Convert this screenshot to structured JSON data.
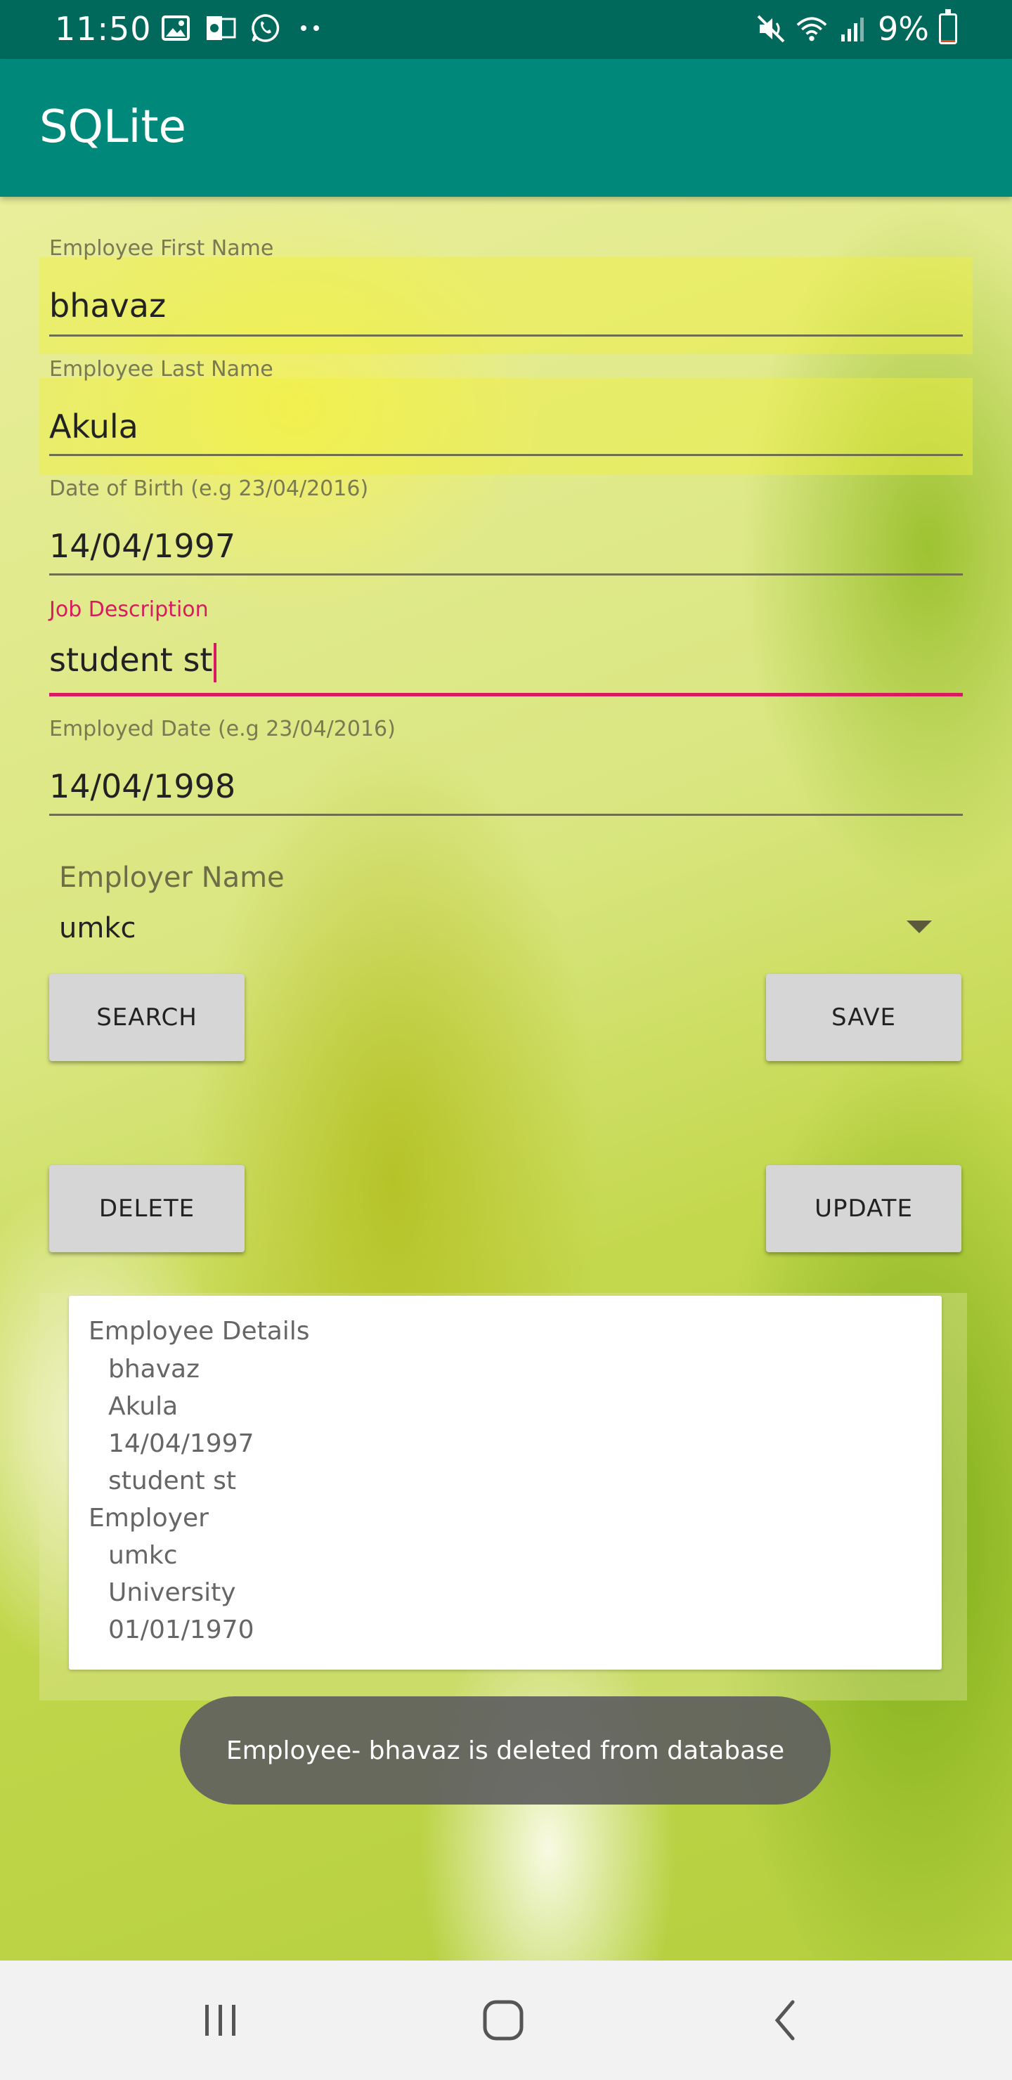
{
  "status_bar": {
    "time": "11:50",
    "battery": "9%",
    "battery_level": 0.09,
    "left_icons": [
      "image-icon",
      "outlook-icon",
      "whatsapp-icon",
      "more-dots-icon"
    ],
    "right_icons": [
      "mute-icon",
      "wifi-icon",
      "signal-icon",
      "battery-icon"
    ]
  },
  "app_bar": {
    "title": "SQLite"
  },
  "form": {
    "first_name": {
      "label": "Employee First Name",
      "value": "bhavaz"
    },
    "last_name": {
      "label": "Employee Last Name",
      "value": "Akula"
    },
    "dob": {
      "label": "Date of Birth (e.g 23/04/2016)",
      "value": "14/04/1997"
    },
    "job": {
      "label": "Job Description",
      "value": "student st"
    },
    "employed_date": {
      "label": "Employed Date (e.g 23/04/2016)",
      "value": "14/04/1998"
    },
    "employer": {
      "label": "Employer Name",
      "value": "umkc"
    }
  },
  "buttons": {
    "search": "SEARCH",
    "save": "SAVE",
    "delete": "DELETE",
    "update": "UPDATE"
  },
  "details": {
    "employee_header": "Employee Details",
    "employee_lines": [
      "bhavaz",
      "Akula",
      "14/04/1997",
      "student st"
    ],
    "employer_header": "Employer",
    "employer_lines": [
      "umkc",
      "University",
      "01/01/1970"
    ]
  },
  "toast": "Employee- bhavaz  is deleted from database",
  "colors": {
    "status_bar": "#00695c",
    "app_bar": "#00897b",
    "accent": "#d81b60",
    "button": "#d6d6d6",
    "toast": "#5f5f5f"
  }
}
